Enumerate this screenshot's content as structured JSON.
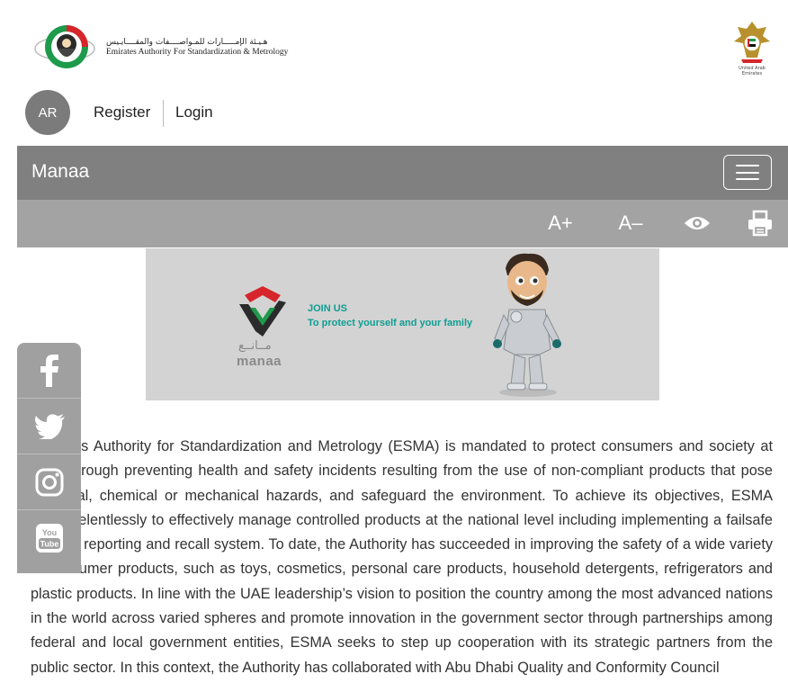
{
  "header": {
    "org_name_ar": "هـيـئة الإمـــــارات للمـواصــــفات والمقــــايـيس",
    "org_name_en": "Emirates Authority For Standardization & Metrology",
    "emblem_caption": "United Arab Emirates"
  },
  "auth": {
    "language_label": "AR",
    "register_label": "Register",
    "login_label": "Login"
  },
  "navbar": {
    "brand": "Manaa"
  },
  "accessibility": {
    "increase_font": "A+",
    "decrease_font": "A–"
  },
  "banner": {
    "title": "JOIN US",
    "subtitle": "To protect yourself and your family",
    "logo_ar": "مــانــع",
    "logo_en": "manaa"
  },
  "social": {
    "youtube_text_1": "You",
    "youtube_text_2": "Tube"
  },
  "content": {
    "paragraph": "Emirates Authority for Standardization and Metrology (ESMA) is mandated to protect consumers and society at large through preventing health and safety incidents resulting from the use of non-compliant products that pose electrical, chemical or mechanical hazards, and safeguard the environment. To achieve its objectives, ESMA works relentlessly to effectively manage controlled products at the national level including implementing a failsafe product reporting and recall system. To date, the Authority has succeeded in improving the safety of a wide variety of consumer products, such as toys, cosmetics, personal care products, household detergents, refrigerators and plastic products. In line with the UAE leadership’s vision to position the country among the most advanced nations in the world across varied spheres and promote innovation in the government sector through partnerships among federal and local government entities, ESMA seeks to step up cooperation with its strategic partners from the public sector. In this context, the Authority has collaborated with Abu Dhabi Quality and Conformity Council"
  }
}
